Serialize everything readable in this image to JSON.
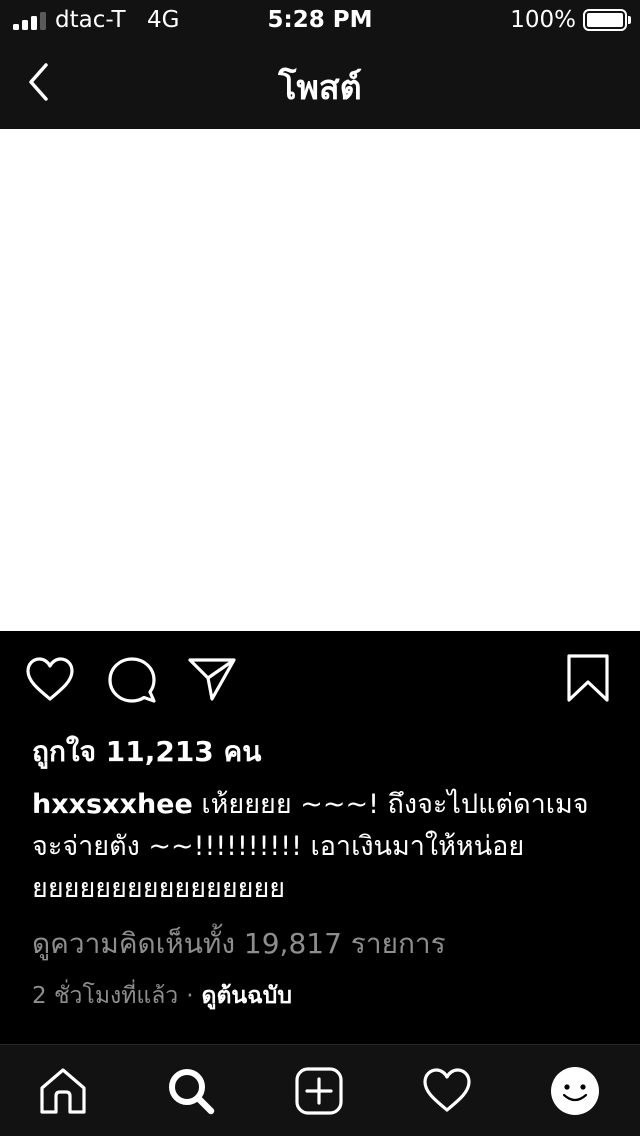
{
  "status_bar": {
    "carrier": "dtac-T",
    "network": "4G",
    "time": "5:28 PM",
    "battery": "100%"
  },
  "header": {
    "title": "โพสต์"
  },
  "post": {
    "likes": "ถูกใจ 11,213 คน",
    "username": "hxxsxxhee",
    "caption_text": " เห้ยยยย ~~~! ถึงจะไปแต่ดาเมจจะจ่ายตัง ~~!!!!!!!!!! เอาเงินมาให้หน่อยยยยยยยยยยยยยยยยย",
    "view_comments": "ดูความคิดเห็นทั้ง 19,817 รายการ",
    "time_ago": "2 ชั่วโมงที่แล้ว",
    "separator": "·",
    "see_original": "ดูต้นฉบับ"
  },
  "icons": {
    "back": "chevron-left-icon",
    "like": "heart-icon",
    "comment": "comment-icon",
    "share": "paper-plane-icon",
    "save": "bookmark-icon",
    "tabs": [
      "home-icon",
      "search-icon",
      "plus-square-icon",
      "heart-icon",
      "avatar"
    ]
  },
  "colors": {
    "background": "#000000",
    "bar_background": "#121212",
    "secondary_text": "#8e8e8e",
    "post_image": "#ffffff"
  }
}
